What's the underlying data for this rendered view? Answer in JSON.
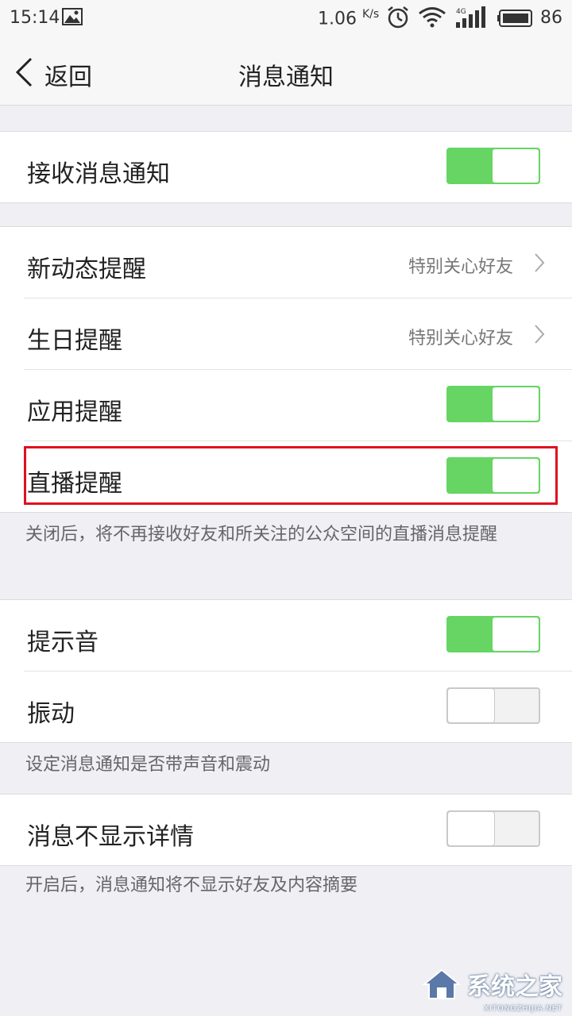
{
  "status_bar": {
    "time": "15:14",
    "speed": "1.06",
    "speed_unit": "K/s",
    "network": "4G",
    "battery": "86"
  },
  "nav": {
    "back_label": "返回",
    "title": "消息通知"
  },
  "groups": {
    "g1": {
      "receive": {
        "label": "接收消息通知",
        "on": true
      }
    },
    "g2": {
      "new_activity": {
        "label": "新动态提醒",
        "value": "特别关心好友"
      },
      "birthday": {
        "label": "生日提醒",
        "value": "特别关心好友"
      },
      "app": {
        "label": "应用提醒",
        "on": true
      },
      "live": {
        "label": "直播提醒",
        "on": true
      },
      "hint": "关闭后，将不再接收好友和所关注的公众空间的直播消息提醒"
    },
    "g3": {
      "sound": {
        "label": "提示音",
        "on": true
      },
      "vibrate": {
        "label": "振动",
        "on": false
      },
      "hint": "设定消息通知是否带声音和震动"
    },
    "g4": {
      "hide_detail": {
        "label": "消息不显示详情",
        "on": false
      },
      "hint": "开启后，消息通知将不显示好友及内容摘要"
    }
  },
  "watermark": {
    "text": "系统之家",
    "sub": "XITONGZHIJIA.NET"
  },
  "colors": {
    "toggle_on": "#66d563",
    "highlight": "#e01020",
    "background": "#efeff4"
  }
}
